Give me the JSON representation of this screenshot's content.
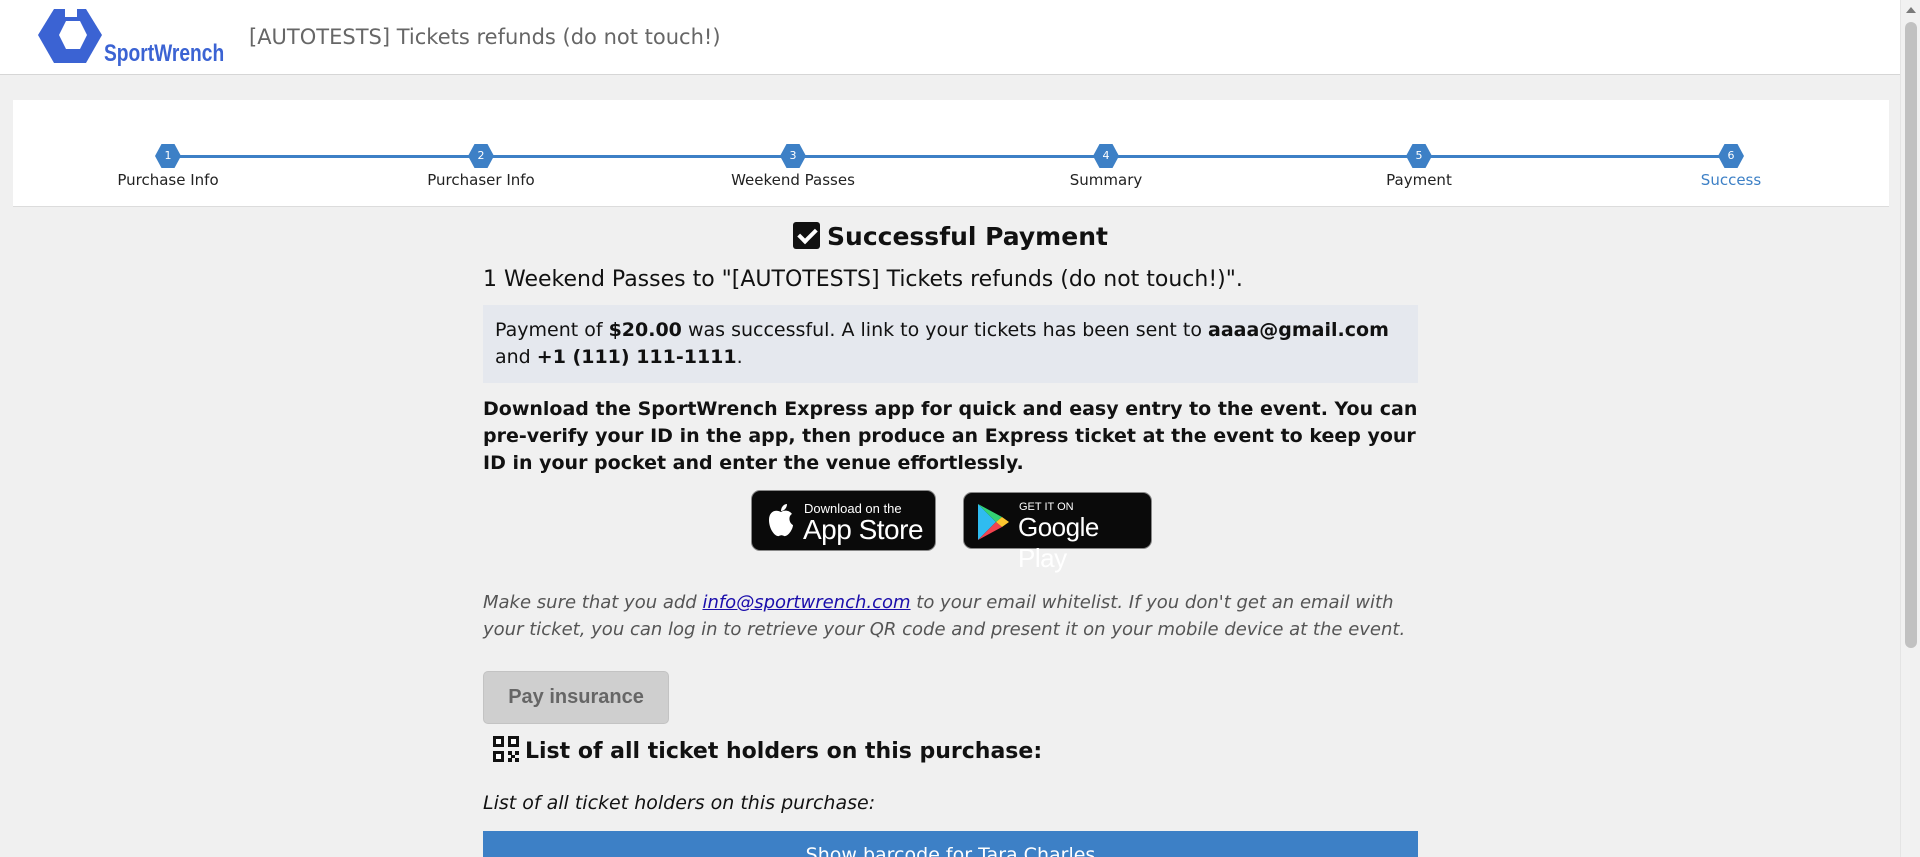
{
  "header": {
    "logo_text": "SportWrench",
    "event_title": "[AUTOTESTS] Tickets refunds (do not touch!)"
  },
  "steps": [
    {
      "number": "1",
      "label": "Purchase Info"
    },
    {
      "number": "2",
      "label": "Purchaser Info"
    },
    {
      "number": "3",
      "label": "Weekend Passes"
    },
    {
      "number": "4",
      "label": "Summary"
    },
    {
      "number": "5",
      "label": "Payment"
    },
    {
      "number": "6",
      "label": "Success"
    }
  ],
  "active_step": "Success",
  "success": {
    "heading": "Successful Payment",
    "passes_line": "1 Weekend Passes to \"[AUTOTESTS] Tickets refunds (do not touch!)\".",
    "payment_prefix": "Payment of ",
    "amount": "$20.00",
    "payment_mid": " was successful. A link to your tickets has been sent to ",
    "email": "aaaa@gmail.com",
    "and_text": " and ",
    "phone": "+1 (111) 111-1111",
    "period": ".",
    "download_text": "Download the SportWrench Express app for quick and easy entry to the event. You can pre-verify your ID in the app, then produce an Express ticket at the event to keep your ID in your pocket and enter the venue effortlessly."
  },
  "badges": {
    "apple_small": "Download on the",
    "apple_big": "App Store",
    "google_small": "GET IT ON",
    "google_big": "Google Play"
  },
  "note": {
    "prefix": "Make sure that you add ",
    "link": "info@sportwrench.com",
    "suffix": " to your email whitelist. If you don't get an email with your ticket, you can log in to retrieve your QR code and present it on your mobile device at the event."
  },
  "insurance_button": "Pay insurance",
  "holders": {
    "heading": "List of all ticket holders on this purchase:",
    "subheading": "List of all ticket holders on this purchase:",
    "barcode_button": "Show barcode for Tara Charles"
  },
  "colors": {
    "accent": "#3d80c6",
    "logo": "#3b63d3",
    "background": "#f0f0f0",
    "payment_box": "#e5e8ee"
  },
  "icons": [
    "sportwrench-logo-icon",
    "checkbox-checked-icon",
    "apple-icon",
    "google-play-icon",
    "qr-code-icon"
  ]
}
